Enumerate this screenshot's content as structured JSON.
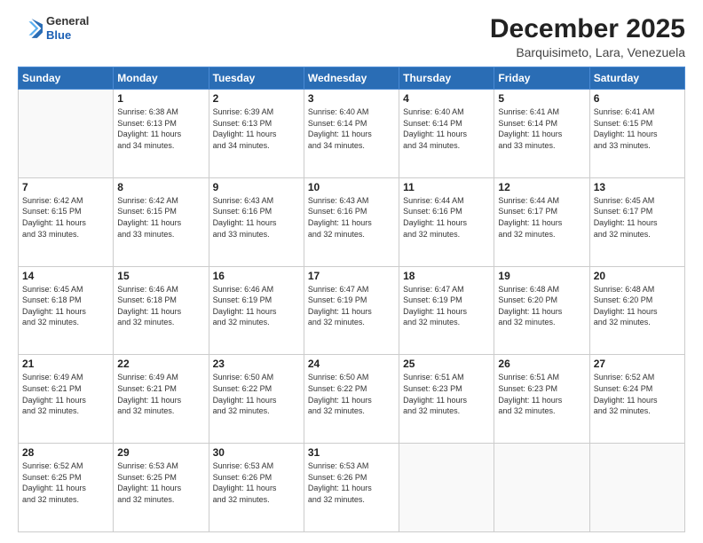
{
  "header": {
    "logo_line1": "General",
    "logo_line2": "Blue",
    "title": "December 2025",
    "subtitle": "Barquisimeto, Lara, Venezuela"
  },
  "calendar": {
    "days_of_week": [
      "Sunday",
      "Monday",
      "Tuesday",
      "Wednesday",
      "Thursday",
      "Friday",
      "Saturday"
    ],
    "weeks": [
      [
        {
          "day": "",
          "info": ""
        },
        {
          "day": "1",
          "info": "Sunrise: 6:38 AM\nSunset: 6:13 PM\nDaylight: 11 hours\nand 34 minutes."
        },
        {
          "day": "2",
          "info": "Sunrise: 6:39 AM\nSunset: 6:13 PM\nDaylight: 11 hours\nand 34 minutes."
        },
        {
          "day": "3",
          "info": "Sunrise: 6:40 AM\nSunset: 6:14 PM\nDaylight: 11 hours\nand 34 minutes."
        },
        {
          "day": "4",
          "info": "Sunrise: 6:40 AM\nSunset: 6:14 PM\nDaylight: 11 hours\nand 34 minutes."
        },
        {
          "day": "5",
          "info": "Sunrise: 6:41 AM\nSunset: 6:14 PM\nDaylight: 11 hours\nand 33 minutes."
        },
        {
          "day": "6",
          "info": "Sunrise: 6:41 AM\nSunset: 6:15 PM\nDaylight: 11 hours\nand 33 minutes."
        }
      ],
      [
        {
          "day": "7",
          "info": "Sunrise: 6:42 AM\nSunset: 6:15 PM\nDaylight: 11 hours\nand 33 minutes."
        },
        {
          "day": "8",
          "info": "Sunrise: 6:42 AM\nSunset: 6:15 PM\nDaylight: 11 hours\nand 33 minutes."
        },
        {
          "day": "9",
          "info": "Sunrise: 6:43 AM\nSunset: 6:16 PM\nDaylight: 11 hours\nand 33 minutes."
        },
        {
          "day": "10",
          "info": "Sunrise: 6:43 AM\nSunset: 6:16 PM\nDaylight: 11 hours\nand 32 minutes."
        },
        {
          "day": "11",
          "info": "Sunrise: 6:44 AM\nSunset: 6:16 PM\nDaylight: 11 hours\nand 32 minutes."
        },
        {
          "day": "12",
          "info": "Sunrise: 6:44 AM\nSunset: 6:17 PM\nDaylight: 11 hours\nand 32 minutes."
        },
        {
          "day": "13",
          "info": "Sunrise: 6:45 AM\nSunset: 6:17 PM\nDaylight: 11 hours\nand 32 minutes."
        }
      ],
      [
        {
          "day": "14",
          "info": "Sunrise: 6:45 AM\nSunset: 6:18 PM\nDaylight: 11 hours\nand 32 minutes."
        },
        {
          "day": "15",
          "info": "Sunrise: 6:46 AM\nSunset: 6:18 PM\nDaylight: 11 hours\nand 32 minutes."
        },
        {
          "day": "16",
          "info": "Sunrise: 6:46 AM\nSunset: 6:19 PM\nDaylight: 11 hours\nand 32 minutes."
        },
        {
          "day": "17",
          "info": "Sunrise: 6:47 AM\nSunset: 6:19 PM\nDaylight: 11 hours\nand 32 minutes."
        },
        {
          "day": "18",
          "info": "Sunrise: 6:47 AM\nSunset: 6:19 PM\nDaylight: 11 hours\nand 32 minutes."
        },
        {
          "day": "19",
          "info": "Sunrise: 6:48 AM\nSunset: 6:20 PM\nDaylight: 11 hours\nand 32 minutes."
        },
        {
          "day": "20",
          "info": "Sunrise: 6:48 AM\nSunset: 6:20 PM\nDaylight: 11 hours\nand 32 minutes."
        }
      ],
      [
        {
          "day": "21",
          "info": "Sunrise: 6:49 AM\nSunset: 6:21 PM\nDaylight: 11 hours\nand 32 minutes."
        },
        {
          "day": "22",
          "info": "Sunrise: 6:49 AM\nSunset: 6:21 PM\nDaylight: 11 hours\nand 32 minutes."
        },
        {
          "day": "23",
          "info": "Sunrise: 6:50 AM\nSunset: 6:22 PM\nDaylight: 11 hours\nand 32 minutes."
        },
        {
          "day": "24",
          "info": "Sunrise: 6:50 AM\nSunset: 6:22 PM\nDaylight: 11 hours\nand 32 minutes."
        },
        {
          "day": "25",
          "info": "Sunrise: 6:51 AM\nSunset: 6:23 PM\nDaylight: 11 hours\nand 32 minutes."
        },
        {
          "day": "26",
          "info": "Sunrise: 6:51 AM\nSunset: 6:23 PM\nDaylight: 11 hours\nand 32 minutes."
        },
        {
          "day": "27",
          "info": "Sunrise: 6:52 AM\nSunset: 6:24 PM\nDaylight: 11 hours\nand 32 minutes."
        }
      ],
      [
        {
          "day": "28",
          "info": "Sunrise: 6:52 AM\nSunset: 6:25 PM\nDaylight: 11 hours\nand 32 minutes."
        },
        {
          "day": "29",
          "info": "Sunrise: 6:53 AM\nSunset: 6:25 PM\nDaylight: 11 hours\nand 32 minutes."
        },
        {
          "day": "30",
          "info": "Sunrise: 6:53 AM\nSunset: 6:26 PM\nDaylight: 11 hours\nand 32 minutes."
        },
        {
          "day": "31",
          "info": "Sunrise: 6:53 AM\nSunset: 6:26 PM\nDaylight: 11 hours\nand 32 minutes."
        },
        {
          "day": "",
          "info": ""
        },
        {
          "day": "",
          "info": ""
        },
        {
          "day": "",
          "info": ""
        }
      ]
    ]
  }
}
